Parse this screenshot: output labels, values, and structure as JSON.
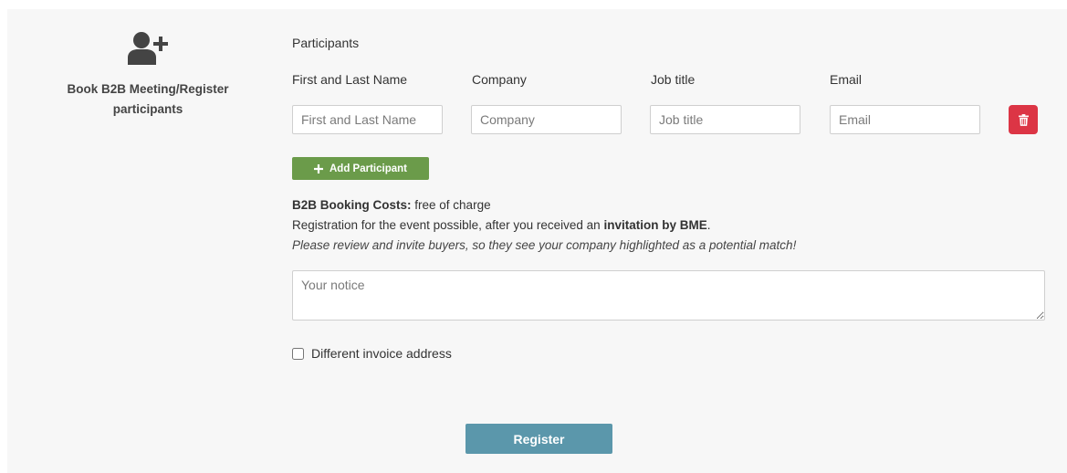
{
  "colors": {
    "panel_background": "#f7f7f7",
    "add_participant_button": "#6b9b4a",
    "delete_button": "#dc3545",
    "register_button": "#5b97ab"
  },
  "registration": {
    "icon": "user-plus-icon",
    "title": "Book B2B Meeting/Register participants"
  },
  "participants": {
    "heading": "Participants",
    "fields": [
      {
        "label": "First and Last Name",
        "placeholder": "First and Last Name"
      },
      {
        "label": "Company",
        "placeholder": "Company"
      },
      {
        "label": "Job title",
        "placeholder": "Job title"
      },
      {
        "label": "Email",
        "placeholder": "Email"
      }
    ],
    "delete_icon": "trash-icon",
    "add_button": {
      "icon": "plus-icon",
      "label": "Add Participant"
    }
  },
  "info": {
    "costs_label": "B2B Booking Costs:",
    "costs_value": "free of charge",
    "registration_text": "Registration for the event possible, after you received an",
    "registration_bold": "invitation by BME",
    "registration_end": ".",
    "review_note": "Please review and invite buyers, so they see your company highlighted as a potential match!"
  },
  "notice": {
    "placeholder": "Your notice"
  },
  "invoice": {
    "label": "Different invoice address",
    "checked": false
  },
  "register_button": {
    "label": "Register"
  }
}
